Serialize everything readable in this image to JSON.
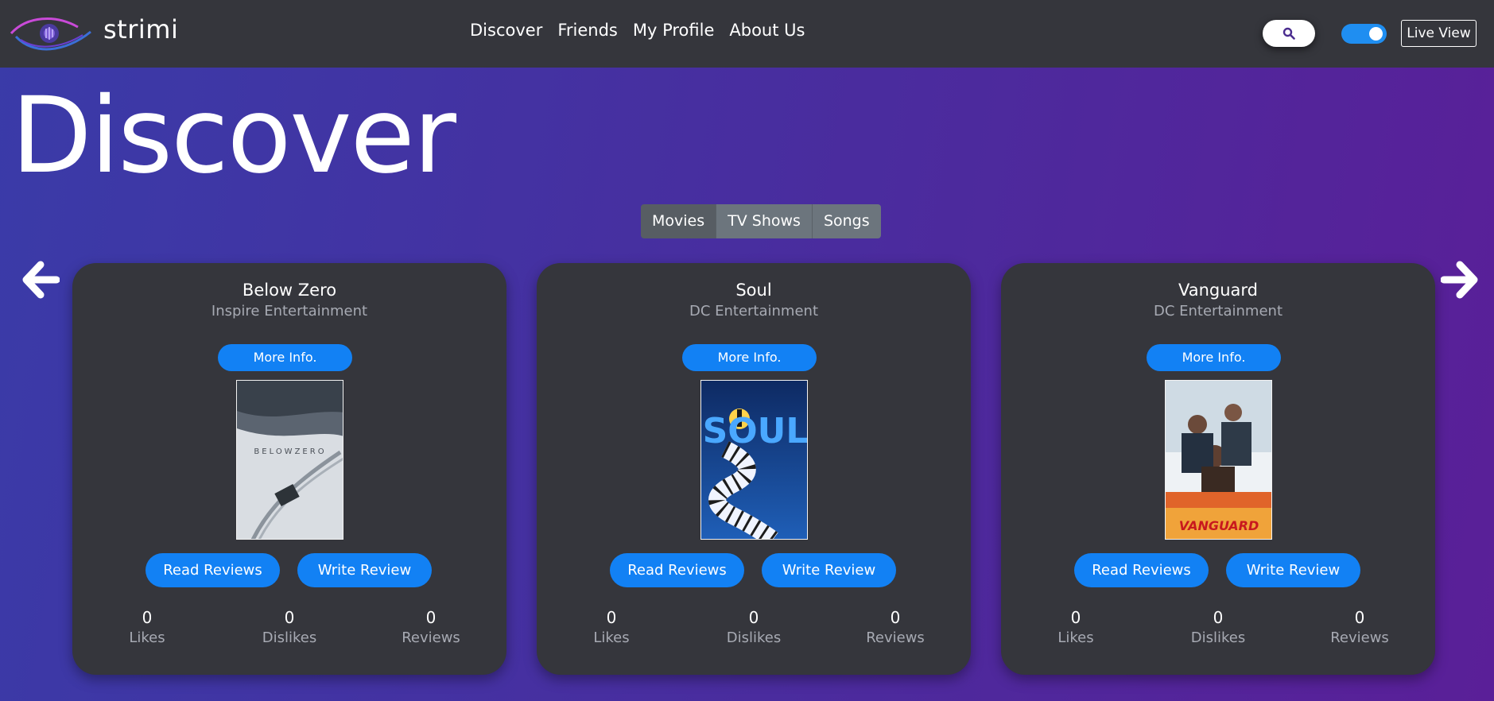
{
  "brand": {
    "name": "strimi",
    "icon": "eye-logo-icon"
  },
  "nav": {
    "items": [
      {
        "label": "Discover"
      },
      {
        "label": "Friends"
      },
      {
        "label": "My Profile"
      },
      {
        "label": "About Us"
      }
    ]
  },
  "header": {
    "search_icon": "search-icon",
    "toggle_on": true,
    "live_view_label": "Live View"
  },
  "page": {
    "title": "Discover"
  },
  "categories": {
    "items": [
      {
        "label": "Movies",
        "active": true
      },
      {
        "label": "TV Shows",
        "active": false
      },
      {
        "label": "Songs",
        "active": false
      }
    ]
  },
  "carousel": {
    "prev_icon": "arrow-left-icon",
    "next_icon": "arrow-right-icon"
  },
  "cards": [
    {
      "title": "Below Zero",
      "studio": "Inspire Entertainment",
      "more_label": "More Info.",
      "poster_text": "BELOWZERO",
      "read_label": "Read Reviews",
      "write_label": "Write Review",
      "likes": "0",
      "likes_label": "Likes",
      "dislikes": "0",
      "dislikes_label": "Dislikes",
      "reviews": "0",
      "reviews_label": "Reviews"
    },
    {
      "title": "Soul",
      "studio": "DC Entertainment",
      "more_label": "More Info.",
      "poster_text": "SOUL",
      "read_label": "Read Reviews",
      "write_label": "Write Review",
      "likes": "0",
      "likes_label": "Likes",
      "dislikes": "0",
      "dislikes_label": "Dislikes",
      "reviews": "0",
      "reviews_label": "Reviews"
    },
    {
      "title": "Vanguard",
      "studio": "DC Entertainment",
      "more_label": "More Info.",
      "poster_text": "VANGUARD",
      "read_label": "Read Reviews",
      "write_label": "Write Review",
      "likes": "0",
      "likes_label": "Likes",
      "dislikes": "0",
      "dislikes_label": "Dislikes",
      "reviews": "0",
      "reviews_label": "Reviews"
    }
  ],
  "colors": {
    "navbar": "#35363c",
    "card": "#35363c",
    "accent": "#1281f4",
    "muted_text": "#a7aab3"
  }
}
